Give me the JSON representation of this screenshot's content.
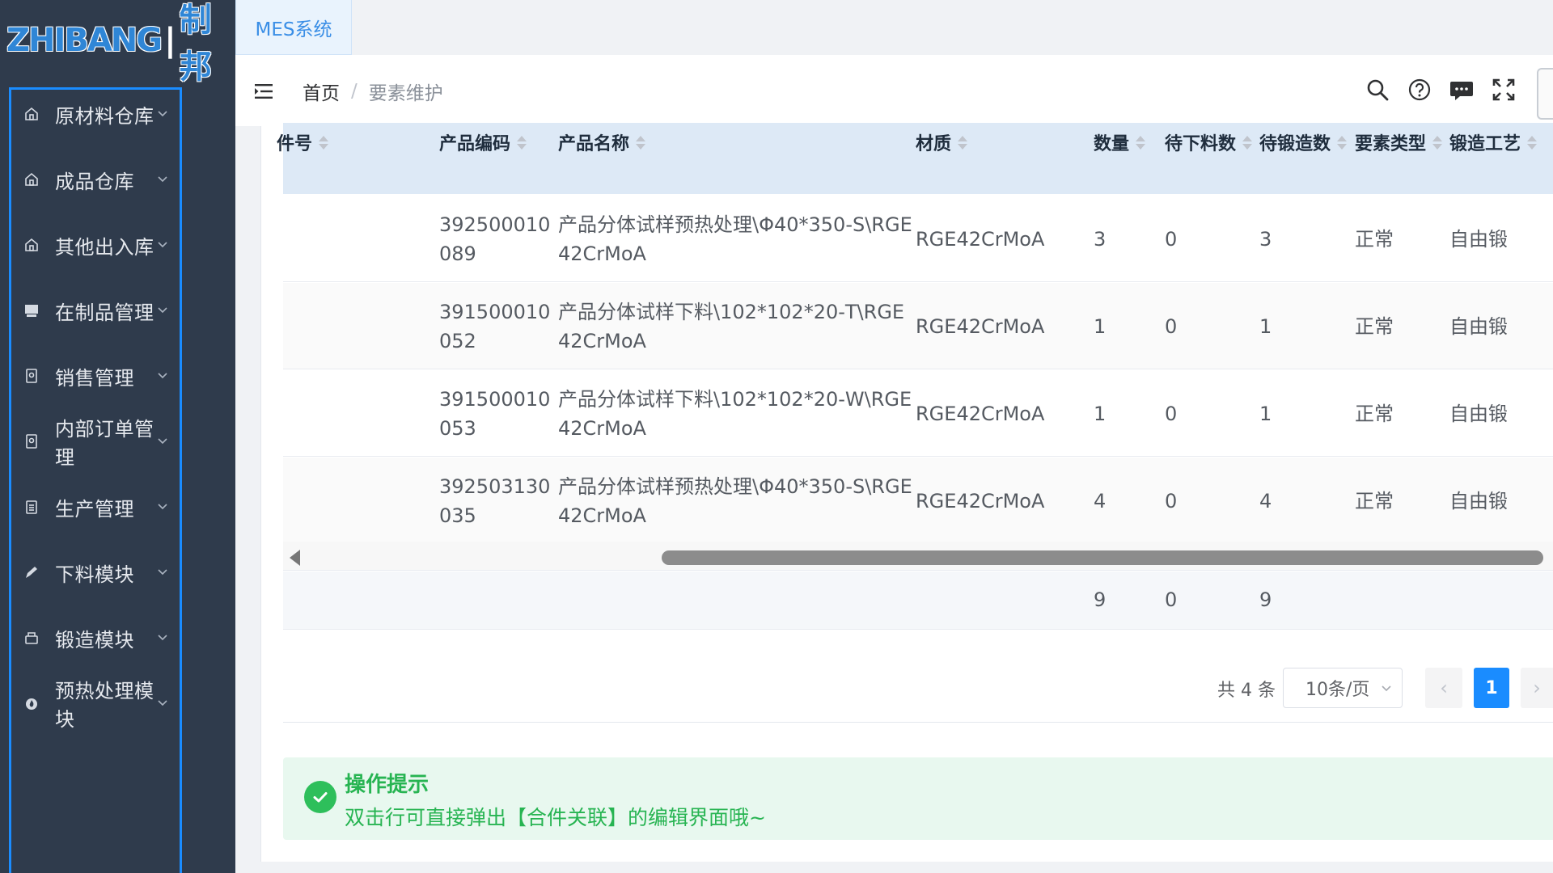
{
  "brand": {
    "logo_text": "ZHIBANG",
    "logo_cn": "制邦"
  },
  "tab": {
    "label": "MES系统"
  },
  "breadcrumb": {
    "home": "首页",
    "separator": "/",
    "current": "要素维护"
  },
  "sidebar": {
    "items": [
      {
        "label": "原材料仓库",
        "icon": "home-icon"
      },
      {
        "label": "成品仓库",
        "icon": "home-icon"
      },
      {
        "label": "其他出入库",
        "icon": "home-icon"
      },
      {
        "label": "在制品管理",
        "icon": "monitor-icon"
      },
      {
        "label": "销售管理",
        "icon": "document-icon"
      },
      {
        "label": "内部订单管理",
        "icon": "document-icon"
      },
      {
        "label": "生产管理",
        "icon": "clipboard-icon"
      },
      {
        "label": "下料模块",
        "icon": "pen-icon"
      },
      {
        "label": "锻造模块",
        "icon": "tool-icon"
      },
      {
        "label": "预热处理模块",
        "icon": "fire-icon"
      }
    ]
  },
  "table": {
    "headers": {
      "part_no": "件号",
      "product_code": "产品编码",
      "product_name": "产品名称",
      "material": "材质",
      "quantity": "数量",
      "pending_cut": "待下料数",
      "pending_forge": "待锻造数",
      "element_type": "要素类型",
      "forge_process": "锻造工艺"
    },
    "rows": [
      {
        "code": "392500010089",
        "name": "产品分体试样预热处理\\Φ40*350-S\\RGE42CrMoA",
        "material": "RGE42CrMoA",
        "qty": "3",
        "pending_cut": "0",
        "pending_forge": "3",
        "type": "正常",
        "process": "自由锻"
      },
      {
        "code": "391500010052",
        "name": "产品分体试样下料\\102*102*20-T\\RGE42CrMoA",
        "material": "RGE42CrMoA",
        "qty": "1",
        "pending_cut": "0",
        "pending_forge": "1",
        "type": "正常",
        "process": "自由锻"
      },
      {
        "code": "391500010053",
        "name": "产品分体试样下料\\102*102*20-W\\RGE42CrMoA",
        "material": "RGE42CrMoA",
        "qty": "1",
        "pending_cut": "0",
        "pending_forge": "1",
        "type": "正常",
        "process": "自由锻"
      },
      {
        "code": "392503130035",
        "name": "产品分体试样预热处理\\Φ40*350-S\\RGE42CrMoA",
        "material": "RGE42CrMoA",
        "qty": "4",
        "pending_cut": "0",
        "pending_forge": "4",
        "type": "正常",
        "process": "自由锻"
      }
    ],
    "summary": {
      "qty": "9",
      "pending_cut": "0",
      "pending_forge": "9"
    }
  },
  "pagination": {
    "total": "共 4 条",
    "page_size": "10条/页",
    "current_page": "1",
    "prev": "‹",
    "next": "›"
  },
  "tip": {
    "title": "操作提示",
    "text": "双击行可直接弹出【合件关联】的编辑界面哦~"
  },
  "colors": {
    "sidebar_bg": "#2f3b4c",
    "accent": "#1a8cff",
    "success": "#27b452",
    "header_bg": "#dde9f6"
  }
}
